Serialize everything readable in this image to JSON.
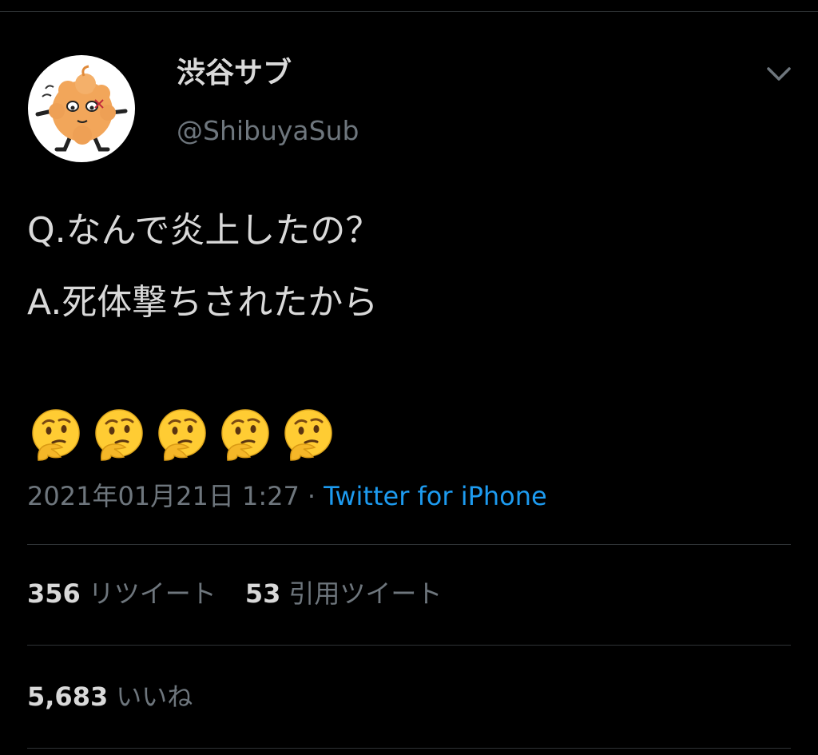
{
  "user": {
    "display_name": "渋谷サブ",
    "handle": "@ShibuyaSub"
  },
  "tweet": {
    "lines": [
      "Q.なんで炎上したの？",
      "A.死体撃ちされたから"
    ],
    "emoji": [
      "thinking-face",
      "thinking-face",
      "thinking-face",
      "thinking-face",
      "thinking-face"
    ]
  },
  "meta": {
    "timestamp": "2021年01月21日 1:27",
    "separator": "·",
    "source": "Twitter for iPhone"
  },
  "stats": {
    "retweets_count": "356",
    "retweets_label": "リツイート",
    "quotes_count": "53",
    "quotes_label": "引用ツイート",
    "likes_count": "5,683",
    "likes_label": "いいね"
  },
  "colors": {
    "background": "#000000",
    "text": "#d9d9d9",
    "muted": "#6e767d",
    "link": "#1d9bf0",
    "divider": "#2f3336"
  }
}
